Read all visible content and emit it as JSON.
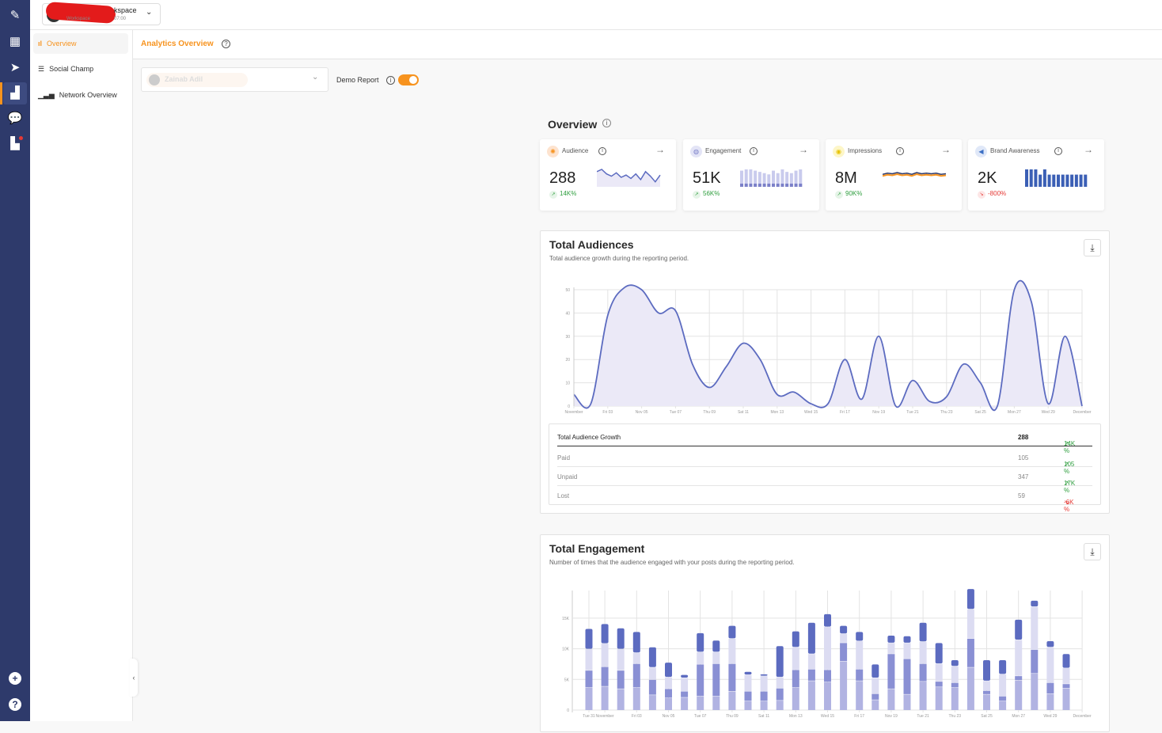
{
  "workspace": {
    "name": "kspace",
    "subtitle": "Workspace",
    "time": "07:00"
  },
  "rail": {
    "icons": [
      "compose-icon",
      "calendar-icon",
      "publish-icon",
      "analytics-icon",
      "inbox-icon",
      "reports-icon"
    ],
    "bottom": [
      "add-icon",
      "help-icon"
    ],
    "add_glyph": "+",
    "help_glyph": "?"
  },
  "sidebar": {
    "items": [
      {
        "label": "Overview",
        "active": true
      },
      {
        "label": "Social Champ"
      },
      {
        "label": "Network Overview"
      }
    ],
    "collapse_glyph": "‹"
  },
  "header": {
    "title": "Analytics Overview"
  },
  "filters": {
    "account": "Zainab Adil",
    "demo_label": "Demo Report",
    "demo_on": true
  },
  "overview": {
    "title": "Overview",
    "cards": [
      {
        "label": "Audience",
        "value": "288",
        "change": "14K%",
        "trend": "up",
        "sparkline": [
          12,
          14,
          10,
          8,
          11,
          7,
          9,
          6,
          10,
          5,
          12,
          8,
          3,
          9
        ]
      },
      {
        "label": "Engagement",
        "value": "51K",
        "change": "56K%",
        "trend": "up",
        "sparkline": [
          13,
          14,
          14,
          13,
          12,
          11,
          10,
          13,
          11,
          14,
          12,
          11,
          13,
          14
        ]
      },
      {
        "label": "Impressions",
        "value": "8M",
        "change": "90K%",
        "trend": "up",
        "sparkline": [
          5,
          7,
          6,
          8,
          6,
          7,
          5,
          8,
          6,
          7,
          6,
          7,
          5,
          6
        ]
      },
      {
        "label": "Brand Awareness",
        "value": "2K",
        "change": "-800%",
        "trend": "down",
        "sparkline": [
          20,
          20,
          20,
          14,
          20,
          14,
          14,
          14,
          14,
          14,
          14,
          14,
          14,
          14
        ]
      }
    ]
  },
  "audiences": {
    "title": "Total Audiences",
    "subtitle": "Total audience growth during the reporting period.",
    "table": [
      {
        "label": "Total Audience Growth",
        "value": "288",
        "change": "14K %",
        "trend": "up"
      },
      {
        "label": "Paid",
        "value": "105",
        "change": "105 %",
        "trend": "up"
      },
      {
        "label": "Unpaid",
        "value": "347",
        "change": "17K %",
        "trend": "up"
      },
      {
        "label": "Lost",
        "value": "59",
        "change": "-6K %",
        "trend": "down"
      }
    ]
  },
  "engagement": {
    "title": "Total Engagement",
    "subtitle": "Number of times that the audience engaged with your posts during the reporting period."
  },
  "colors": {
    "accent": "#f7931e",
    "line": "#5c6bc0",
    "area": "#ebe9f7",
    "seg": [
      "#b1b3e2",
      "#8a90d4",
      "#dcdcf2",
      "#5c6bc0"
    ],
    "up": "#2e9e3e",
    "down": "#e53935"
  },
  "chart_data": [
    {
      "type": "area",
      "x": [
        "Nov 1",
        "Nov 2",
        "Nov 3",
        "Nov 4",
        "Nov 5",
        "Nov 6",
        "Nov 7",
        "Nov 8",
        "Nov 9",
        "Nov 10",
        "Nov 11",
        "Nov 12",
        "Nov 13",
        "Nov 14",
        "Nov 15",
        "Nov 16",
        "Nov 17",
        "Nov 18",
        "Nov 19",
        "Nov 20",
        "Nov 21",
        "Nov 22",
        "Nov 23",
        "Nov 24",
        "Nov 25",
        "Nov 26",
        "Nov 27",
        "Nov 28",
        "Nov 29",
        "Nov 30",
        "Dec 1"
      ],
      "values": [
        5,
        1,
        39,
        51,
        50,
        40,
        41,
        18,
        8,
        17,
        27,
        20,
        5,
        6,
        1,
        1,
        20,
        3,
        30,
        0,
        11,
        2,
        4,
        18,
        10,
        0,
        50,
        45,
        1,
        30,
        0
      ],
      "xticks": [
        "November",
        "Fri 03",
        "Nov 05",
        "Tue 07",
        "Thu 09",
        "Sat 11",
        "Mon 13",
        "Wed 15",
        "Fri 17",
        "Nov 19",
        "Tue 21",
        "Thu 23",
        "Sat 25",
        "Mon 27",
        "Wed 29",
        "December"
      ],
      "yticks": [
        "0",
        "10",
        "20",
        "30",
        "40",
        "50"
      ],
      "ylim": [
        0,
        50
      ],
      "grid": true
    },
    {
      "type": "bar",
      "stacked": true,
      "x": [
        "Oct 31",
        "Nov 1",
        "Nov 2",
        "Nov 3",
        "Nov 4",
        "Nov 5",
        "Nov 6",
        "Nov 7",
        "Nov 8",
        "Nov 9",
        "Nov 10",
        "Nov 11",
        "Nov 12",
        "Nov 13",
        "Nov 14",
        "Nov 15",
        "Nov 16",
        "Nov 17",
        "Nov 18",
        "Nov 19",
        "Nov 20",
        "Nov 21",
        "Nov 22",
        "Nov 23",
        "Nov 24",
        "Nov 25",
        "Nov 26",
        "Nov 27",
        "Nov 28",
        "Nov 29",
        "Nov 30"
      ],
      "series": [
        {
          "values": [
            3700,
            3900,
            3500,
            3700,
            2500,
            2000,
            2100,
            2300,
            2300,
            3100,
            1500,
            1500,
            1600,
            3700,
            4800,
            4600,
            8000,
            4800,
            1700,
            3500,
            2600,
            4700,
            3800,
            3700,
            7000,
            2600,
            1500,
            4900,
            6000,
            2700,
            3600
          ]
        },
        {
          "values": [
            2800,
            3200,
            3000,
            3900,
            2500,
            1500,
            1000,
            5200,
            5300,
            4500,
            1600,
            1600,
            2000,
            2900,
            1900,
            2000,
            3000,
            1900,
            1000,
            5700,
            5800,
            2900,
            900,
            800,
            4700,
            600,
            800,
            700,
            3900,
            1800,
            700
          ]
        },
        {
          "values": [
            3500,
            3800,
            3500,
            1800,
            2000,
            1900,
            2200,
            2000,
            1900,
            4100,
            2700,
            2500,
            1800,
            3700,
            2500,
            7000,
            1500,
            4600,
            2600,
            1800,
            2600,
            3600,
            2900,
            2700,
            4800,
            1600,
            3600,
            5900,
            7000,
            5800,
            2600
          ]
        },
        {
          "values": [
            3300,
            3200,
            3400,
            3400,
            3300,
            2400,
            500,
            3100,
            1900,
            2100,
            500,
            300,
            5100,
            2600,
            5100,
            2100,
            1300,
            1500,
            2200,
            1200,
            1100,
            3100,
            3400,
            1000,
            3300,
            3400,
            2300,
            3300,
            1000,
            1000,
            2300
          ]
        }
      ],
      "xticks": [
        "Tue 31",
        "November",
        "Fri 03",
        "Nov 05",
        "Tue 07",
        "Thu 09",
        "Sat 11",
        "Mon 13",
        "Wed 15",
        "Fri 17",
        "Nov 19",
        "Tue 21",
        "Thu 23",
        "Sat 25",
        "Mon 27",
        "Wed 29",
        "December"
      ],
      "yticks": [
        "0",
        "5K",
        "10K",
        "15K"
      ],
      "ylim": [
        0,
        19500
      ],
      "grid": true
    }
  ]
}
